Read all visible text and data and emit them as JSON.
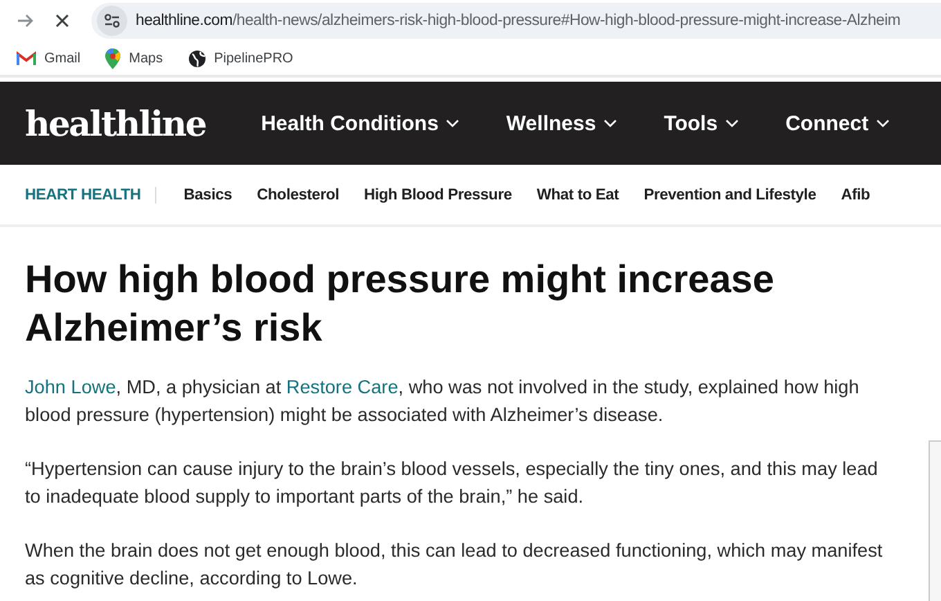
{
  "browser": {
    "url_host": "healthline.com",
    "url_path": "/health-news/alzheimers-risk-high-blood-pressure#How-high-blood-pressure-might-increase-Alzheim",
    "bookmarks": [
      {
        "label": "Gmail",
        "kind": "mail"
      },
      {
        "label": "Maps",
        "kind": "pin"
      },
      {
        "label": "PipelinePRO",
        "kind": "globe"
      }
    ]
  },
  "site": {
    "logo": "healthline",
    "nav": [
      "Health Conditions",
      "Wellness",
      "Tools",
      "Connect"
    ]
  },
  "subnav": {
    "section": "HEART HEALTH",
    "items": [
      "Basics",
      "Cholesterol",
      "High Blood Pressure",
      "What to Eat",
      "Prevention and Lifestyle",
      "Afib"
    ]
  },
  "article": {
    "title": "How high blood pressure might increase Alzheimer’s risk",
    "paragraphs": [
      [
        {
          "text": "John Lowe",
          "link": true
        },
        {
          "text": ", MD, a physician at ",
          "link": false
        },
        {
          "text": "Restore Care",
          "link": true
        },
        {
          "text": ", who was not involved in the study, explained how high blood pressure (hypertension) might be associated with Alzheimer’s disease.",
          "link": false
        }
      ],
      [
        {
          "text": "“Hypertension can cause injury to the brain’s blood vessels, especially the tiny ones, and this may lead to inadequate blood supply to important parts of the brain,” he said.",
          "link": false
        }
      ],
      [
        {
          "text": "When the brain does not get enough blood, this can lead to decreased functioning, which may manifest as cognitive decline, according to Lowe.",
          "link": false
        }
      ]
    ]
  }
}
